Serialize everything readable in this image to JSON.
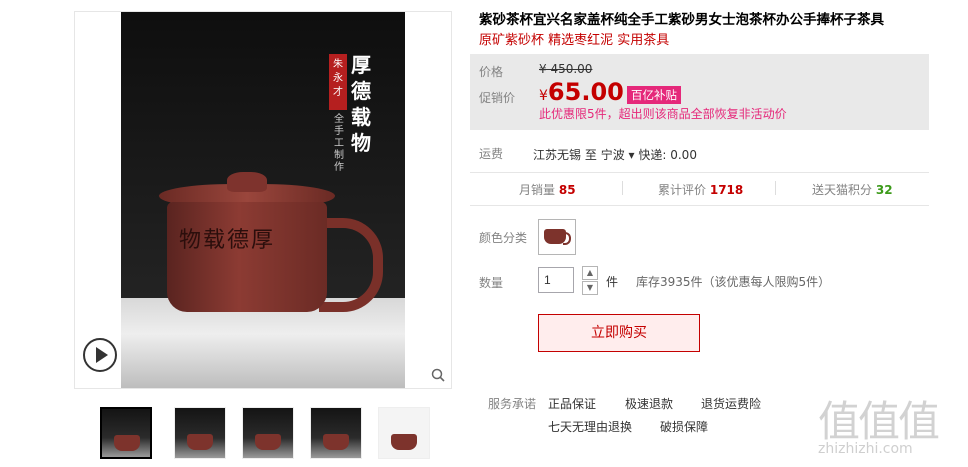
{
  "product": {
    "title": "紫砂茶杯宜兴名家盖杯纯全手工紫砂男女士泡茶杯办公手捧杯子茶具",
    "subtitle": "原矿紫砂杯 精选枣红泥 实用茶具",
    "poster": {
      "maker": "朱永才",
      "headline": "厚德载物",
      "sub": "全手工制作",
      "cup_text": "物载德厚"
    }
  },
  "price": {
    "orig_label": "价格",
    "orig_value": "¥ 450.00",
    "promo_label": "促销价",
    "promo_symbol": "¥",
    "promo_value": "65.00",
    "badge": "百亿补贴",
    "note": "此优惠限5件，超出则该商品全部恢复非活动价"
  },
  "shipping": {
    "label": "运费",
    "from": "江苏无锡",
    "to_word": "至",
    "to": "宁波",
    "express": "快递: 0.00"
  },
  "stats": {
    "monthly_label": "月销量",
    "monthly_value": "85",
    "reviews_label": "累计评价",
    "reviews_value": "1718",
    "points_label": "送天猫积分",
    "points_value": "32"
  },
  "color": {
    "label": "颜色分类"
  },
  "quantity": {
    "label": "数量",
    "value": "1",
    "unit": "件",
    "stock": "库存3935件（该优惠每人限购5件）"
  },
  "buy_label": "立即购买",
  "services": {
    "label": "服务承诺",
    "items": [
      "正品保证",
      "极速退款",
      "退货运费险",
      "七天无理由退换",
      "破损保障"
    ]
  },
  "watermark": {
    "big": "值值值",
    "small": "zhizhizhi.com"
  },
  "colors": {
    "accent": "#c40000",
    "pink": "#e5287a",
    "green": "#3c9a1a"
  }
}
